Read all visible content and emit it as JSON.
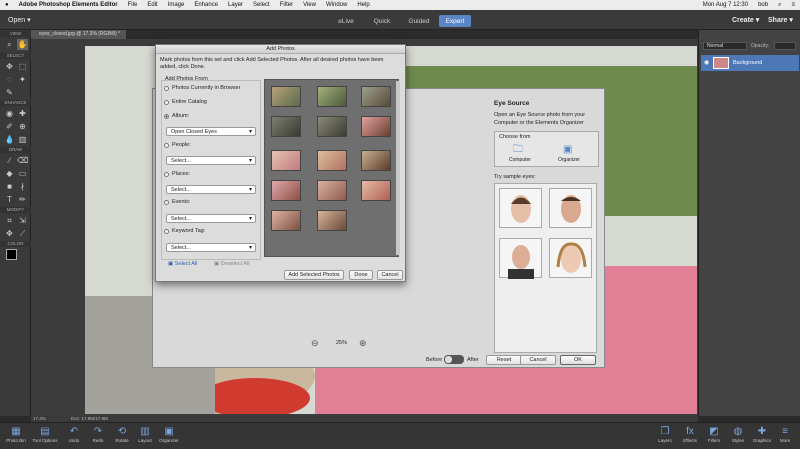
{
  "menubar": {
    "apple": "",
    "app_name": "Adobe Photoshop Elements Editor",
    "items": [
      "File",
      "Edit",
      "Image",
      "Enhance",
      "Layer",
      "Select",
      "Filter",
      "View",
      "Window",
      "Help"
    ],
    "datetime": "Mon Aug 7 12:30",
    "user": "bob"
  },
  "topbar": {
    "open_label": "Open",
    "modes": [
      {
        "label": "eLive"
      },
      {
        "label": "Quick"
      },
      {
        "label": "Guided"
      },
      {
        "label": "Expert"
      }
    ],
    "active_mode": "Expert",
    "create_label": "Create",
    "share_label": "Share"
  },
  "document": {
    "tab_label": "eyes_closed.jpg @ 17.3% (RGB/8) *",
    "zoom_status": "17.3%",
    "doc_status": "Doc: 17.9M/17.9M"
  },
  "toolbar": {
    "sections": [
      "VIEW",
      "SELECT",
      "ENHANCE",
      "DRAW",
      "MODIFY",
      "COLOR"
    ]
  },
  "layers_panel": {
    "blend_mode": "Normal",
    "opacity_label": "Opacity:",
    "layer_name": "Background"
  },
  "eyes_dialog": {
    "heading": "Eye Source",
    "description": "Open an Eye Source photo from your Computer or the Elements Organizer",
    "choose_from": "Choose from",
    "computer_label": "Computer",
    "organizer_label": "Organizer",
    "try_sample": "Try sample eyes:",
    "zoom": "25%",
    "before_label": "Before",
    "after_label": "After",
    "reset_label": "Reset",
    "cancel_label": "Cancel",
    "ok_label": "OK"
  },
  "add_photos": {
    "title": "Add Photos",
    "instructions": "Mark photos from this set and click Add Selected Photos. After all desired photos have been added, click Done.",
    "group_label": "Add Photos From",
    "options": [
      {
        "label": "Photos Currently in Browser",
        "selected": false
      },
      {
        "label": "Entire Catalog",
        "selected": false
      },
      {
        "label": "Album:",
        "selected": true
      },
      {
        "label": "People:",
        "selected": false
      },
      {
        "label": "Places:",
        "selected": false
      },
      {
        "label": "Events:",
        "selected": false
      },
      {
        "label": "Keyword Tag:",
        "selected": false
      }
    ],
    "album_value": "Open Closed Eyes",
    "select_placeholder": "Select...",
    "select_all": "Select All",
    "deselect_all": "Deselect All",
    "add_selected": "Add Selected Photos",
    "done": "Done",
    "cancel": "Cancel"
  },
  "bottombar": {
    "items": [
      "Photo Bin",
      "Tool Options",
      "Undo",
      "Redo",
      "Rotate",
      "Layout",
      "Organizer"
    ],
    "right_items": [
      "Layers",
      "Effects",
      "Filters",
      "Styles",
      "Graphics",
      "More"
    ]
  }
}
